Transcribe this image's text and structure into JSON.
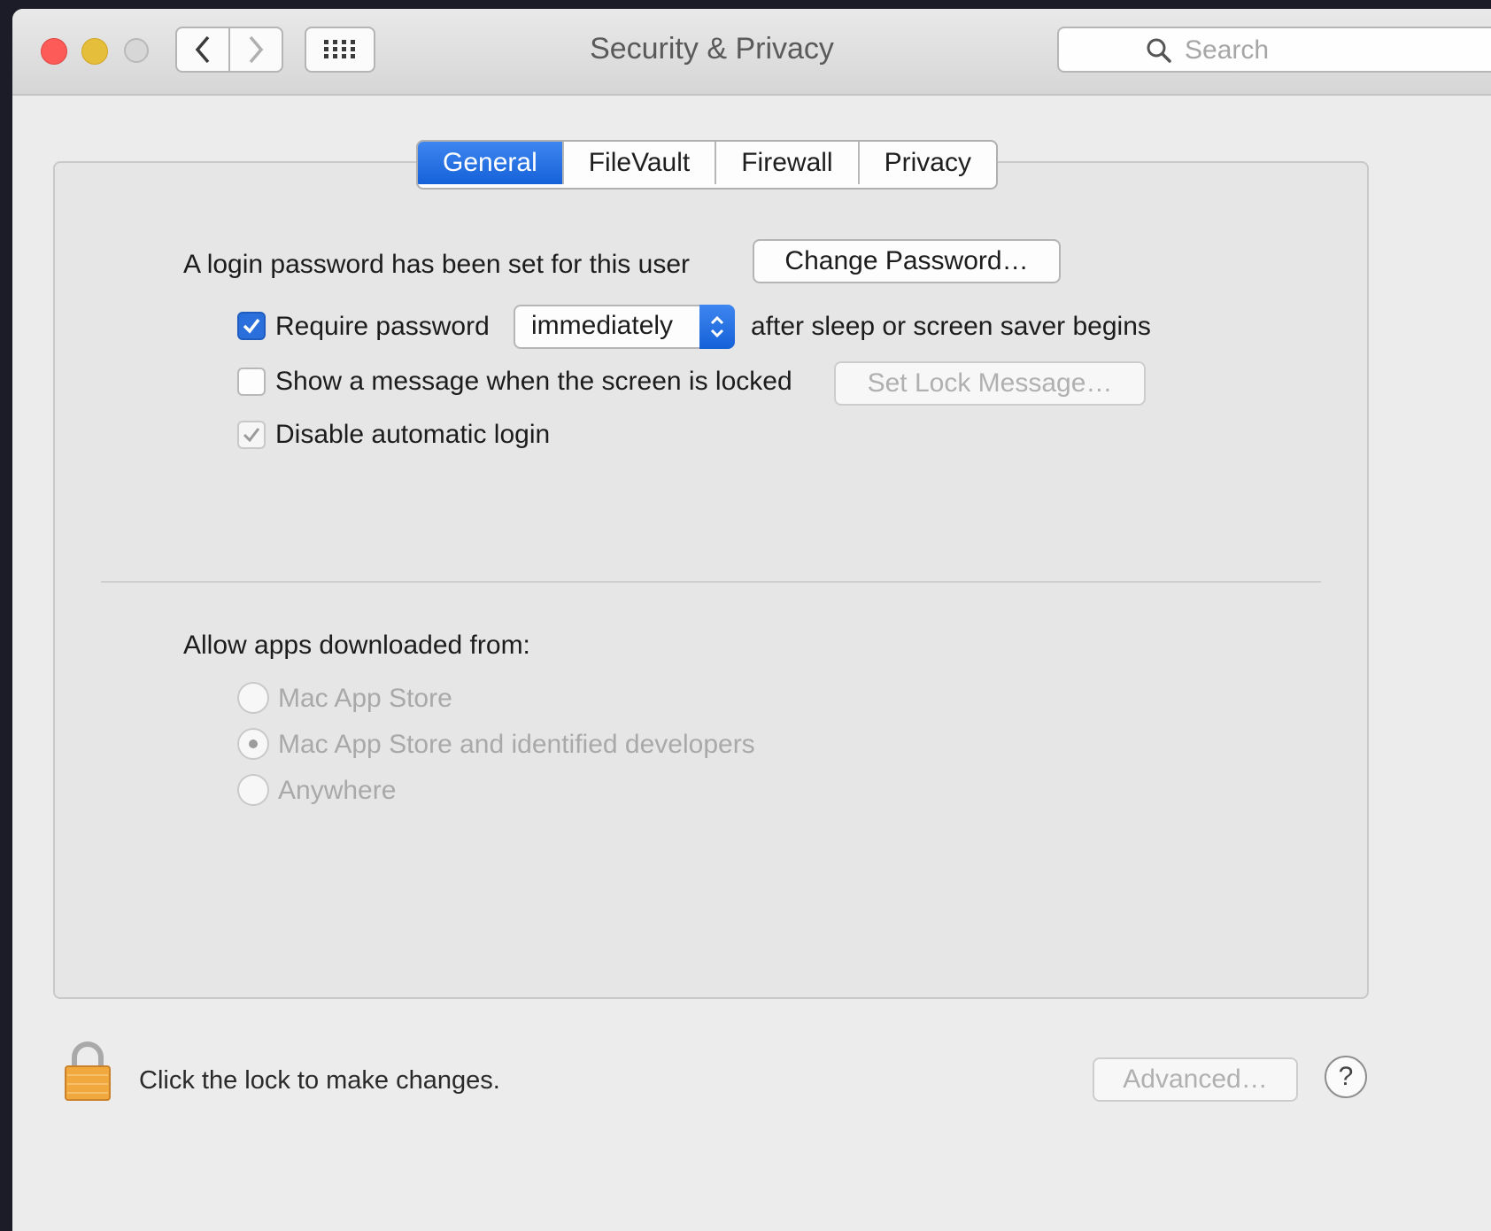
{
  "window": {
    "title": "Security & Privacy",
    "search_placeholder": "Search"
  },
  "tabs": [
    {
      "label": "General",
      "active": true
    },
    {
      "label": "FileVault",
      "active": false
    },
    {
      "label": "Firewall",
      "active": false
    },
    {
      "label": "Privacy",
      "active": false
    }
  ],
  "general": {
    "password_text": "A login password has been set for this user",
    "change_password_button": "Change Password…",
    "require_password_label": "Require password",
    "require_password_checked": true,
    "require_password_value": "immediately",
    "after_sleep_text": "after sleep or screen saver begins",
    "show_message_label": "Show a message when the screen is locked",
    "show_message_checked": false,
    "set_lock_message_button": "Set Lock Message…",
    "disable_auto_login_label": "Disable automatic login",
    "disable_auto_login_checked": true
  },
  "downloads": {
    "heading": "Allow apps downloaded from:",
    "options": [
      {
        "label": "Mac App Store",
        "selected": false
      },
      {
        "label": "Mac App Store and identified developers",
        "selected": true
      },
      {
        "label": "Anywhere",
        "selected": false
      }
    ]
  },
  "footer": {
    "lock_text": "Click the lock to make changes.",
    "advanced_button": "Advanced…",
    "help_label": "?"
  },
  "colors": {
    "accent": "#1561d8",
    "close": "#fc5b57",
    "minimize": "#e5bf3c",
    "lock": "#f1a83c"
  },
  "icons": {
    "back": "chevron-left-icon",
    "forward": "chevron-right-icon",
    "show_all": "grid-icon",
    "search": "search-icon",
    "lock": "lock-icon",
    "help": "help-icon"
  }
}
